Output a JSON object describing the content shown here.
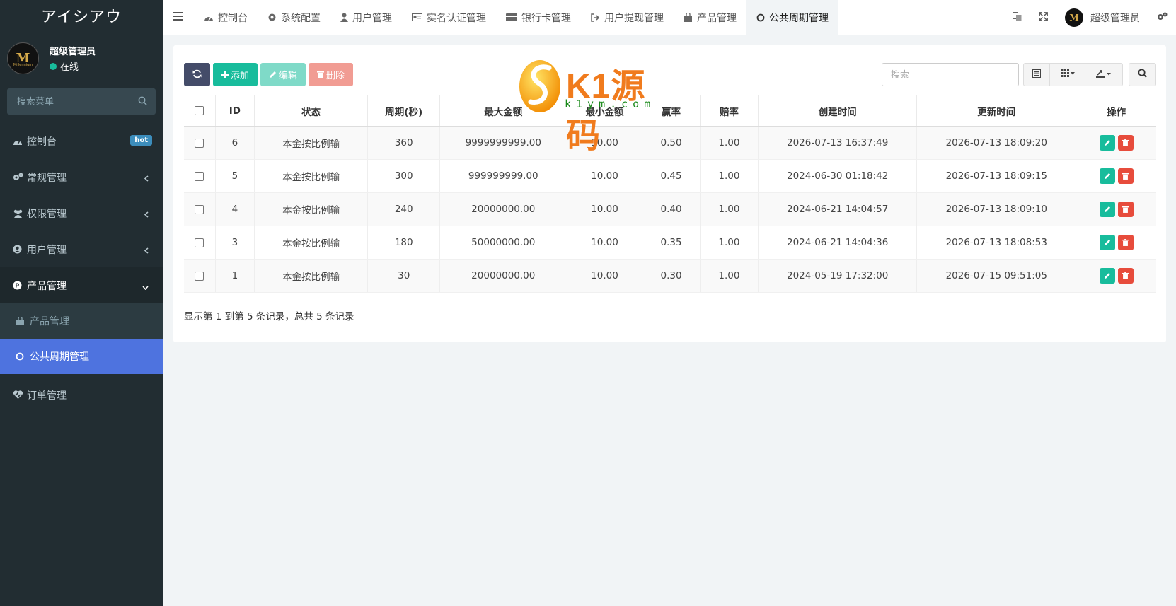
{
  "app": {
    "brand": "アイシアウ"
  },
  "user": {
    "name": "超级管理员",
    "status": "在线",
    "avatar_letter": "M",
    "avatar_small_text": "Millennium"
  },
  "sidebar": {
    "search_placeholder": "搜索菜单",
    "items": [
      {
        "label": "控制台",
        "icon": "dashboard-icon",
        "badge": "hot"
      },
      {
        "label": "常规管理",
        "icon": "cogs-icon"
      },
      {
        "label": "权限管理",
        "icon": "users-icon"
      },
      {
        "label": "用户管理",
        "icon": "user-circle-icon"
      },
      {
        "label": "产品管理",
        "icon": "product-p-icon"
      },
      {
        "label": "订单管理",
        "icon": "heartbeat-icon"
      }
    ],
    "sub_items": [
      {
        "label": "产品管理",
        "icon": "bag-icon"
      },
      {
        "label": "公共周期管理",
        "icon": "circle-icon"
      }
    ]
  },
  "navbar": {
    "tabs": [
      {
        "label": "控制台",
        "icon": "dashboard-icon"
      },
      {
        "label": "系统配置",
        "icon": "gear-icon"
      },
      {
        "label": "用户管理",
        "icon": "user-icon"
      },
      {
        "label": "实名认证管理",
        "icon": "id-card-icon"
      },
      {
        "label": "银行卡管理",
        "icon": "credit-card-icon"
      },
      {
        "label": "用户提现管理",
        "icon": "sign-out-icon"
      },
      {
        "label": "产品管理",
        "icon": "bag-icon"
      },
      {
        "label": "公共周期管理",
        "icon": "circle-icon"
      }
    ],
    "user_label": "超级管理员",
    "avatar_letter": "M"
  },
  "toolbar": {
    "add_label": "添加",
    "edit_label": "编辑",
    "delete_label": "删除",
    "search_placeholder": "搜索"
  },
  "table": {
    "columns": [
      "ID",
      "状态",
      "周期(秒)",
      "最大金额",
      "最小金额",
      "赢率",
      "赔率",
      "创建时间",
      "更新时间",
      "操作"
    ],
    "rows": [
      {
        "id": "6",
        "status": "本金按比例输",
        "period": "360",
        "max": "9999999999.00",
        "min": "10.00",
        "win": "0.50",
        "odds": "1.00",
        "created": "2026-07-13 16:37:49",
        "updated": "2026-07-13 18:09:20"
      },
      {
        "id": "5",
        "status": "本金按比例输",
        "period": "300",
        "max": "999999999.00",
        "min": "10.00",
        "win": "0.45",
        "odds": "1.00",
        "created": "2024-06-30 01:18:42",
        "updated": "2026-07-13 18:09:15"
      },
      {
        "id": "4",
        "status": "本金按比例输",
        "period": "240",
        "max": "20000000.00",
        "min": "10.00",
        "win": "0.40",
        "odds": "1.00",
        "created": "2024-06-21 14:04:57",
        "updated": "2026-07-13 18:09:10"
      },
      {
        "id": "3",
        "status": "本金按比例输",
        "period": "180",
        "max": "50000000.00",
        "min": "10.00",
        "win": "0.35",
        "odds": "1.00",
        "created": "2024-06-21 14:04:36",
        "updated": "2026-07-13 18:08:53"
      },
      {
        "id": "1",
        "status": "本金按比例输",
        "period": "30",
        "max": "20000000.00",
        "min": "10.00",
        "win": "0.30",
        "odds": "1.00",
        "created": "2024-05-19 17:32:00",
        "updated": "2026-07-15 09:51:05"
      }
    ]
  },
  "pagination": {
    "summary": "显示第 1 到第 5 条记录，总共 5 条记录"
  },
  "watermark": {
    "main": "K1源码",
    "sub": "k1ym.com"
  },
  "colors": {
    "sidebar_bg": "#222d32",
    "active_menu": "#4e73df",
    "success": "#18bc9c",
    "danger": "#e74c3c",
    "refresh": "#444c69"
  }
}
